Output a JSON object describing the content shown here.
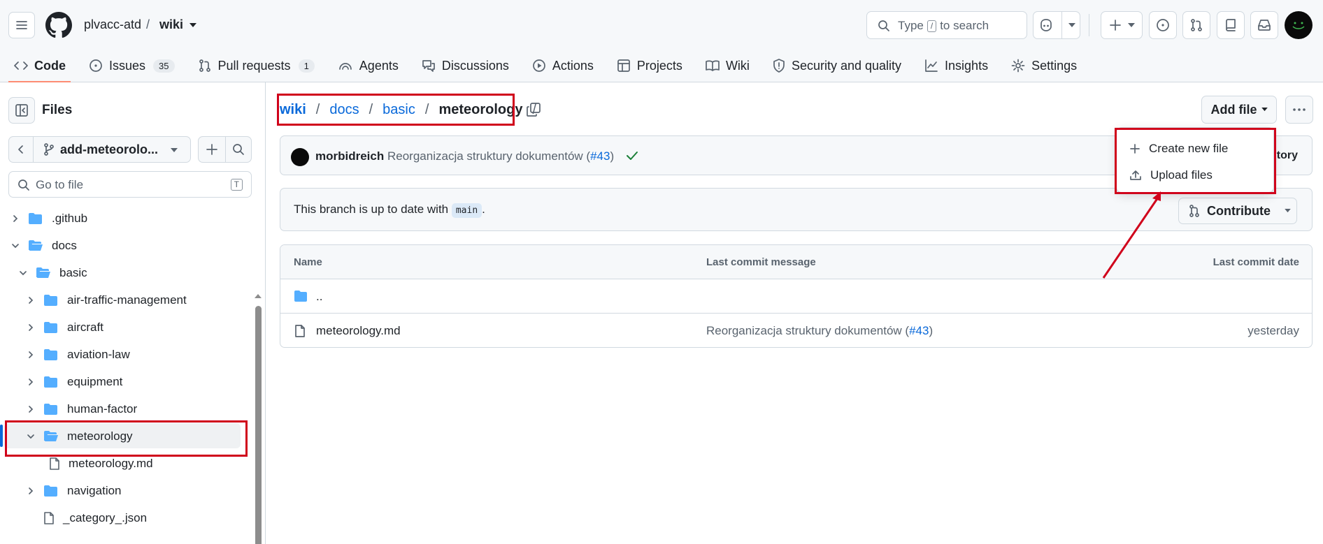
{
  "header": {
    "owner": "plvacc-atd",
    "separator": "/",
    "repo": "wiki",
    "search_placeholder": "Type",
    "search_key": "/",
    "search_suffix": "to search"
  },
  "tabs": [
    {
      "label": "Code",
      "icon": "code-icon"
    },
    {
      "label": "Issues",
      "icon": "issue-icon",
      "count": "35"
    },
    {
      "label": "Pull requests",
      "icon": "pull-request-icon",
      "count": "1"
    },
    {
      "label": "Agents",
      "icon": "agents-icon"
    },
    {
      "label": "Discussions",
      "icon": "discussions-icon"
    },
    {
      "label": "Actions",
      "icon": "actions-icon"
    },
    {
      "label": "Projects",
      "icon": "projects-icon"
    },
    {
      "label": "Wiki",
      "icon": "book-icon"
    },
    {
      "label": "Security and quality",
      "icon": "shield-icon"
    },
    {
      "label": "Insights",
      "icon": "graph-icon"
    },
    {
      "label": "Settings",
      "icon": "gear-icon"
    }
  ],
  "sidebar": {
    "title": "Files",
    "branch": "add-meteorolo...",
    "goto_placeholder": "Go to file",
    "goto_key": "T",
    "tree": [
      {
        "label": ".github",
        "type": "folder",
        "level": 0,
        "expanded": false
      },
      {
        "label": "docs",
        "type": "folder",
        "level": 0,
        "expanded": true
      },
      {
        "label": "basic",
        "type": "folder",
        "level": 1,
        "expanded": true
      },
      {
        "label": "air-traffic-management",
        "type": "folder",
        "level": 2,
        "expanded": false
      },
      {
        "label": "aircraft",
        "type": "folder",
        "level": 2,
        "expanded": false
      },
      {
        "label": "aviation-law",
        "type": "folder",
        "level": 2,
        "expanded": false
      },
      {
        "label": "equipment",
        "type": "folder",
        "level": 2,
        "expanded": false
      },
      {
        "label": "human-factor",
        "type": "folder",
        "level": 2,
        "expanded": false
      },
      {
        "label": "meteorology",
        "type": "folder",
        "level": 2,
        "expanded": true,
        "selected": true
      },
      {
        "label": "meteorology.md",
        "type": "file",
        "level": 3
      },
      {
        "label": "navigation",
        "type": "folder",
        "level": 2,
        "expanded": false
      },
      {
        "label": "_category_.json",
        "type": "file",
        "level": 2
      }
    ]
  },
  "breadcrumb": {
    "root": "wiki",
    "parts": [
      "docs",
      "basic"
    ],
    "current": "meteorology",
    "sep": "/"
  },
  "actions": {
    "add_file": "Add file",
    "create_new_file": "Create new file",
    "upload_files": "Upload files",
    "contribute": "Contribute"
  },
  "commit": {
    "user": "morbidreich",
    "message": "Reorganizacja struktury dokumentów (",
    "pr": "#43",
    "message_end": ")",
    "history": "tory"
  },
  "branch_status": {
    "prefix": "This branch is up to date with",
    "branch": "main",
    "suffix": "."
  },
  "table": {
    "headers": [
      "Name",
      "Last commit message",
      "Last commit date"
    ],
    "parent": "..",
    "rows": [
      {
        "name": "meteorology.md",
        "message": "Reorganizacja struktury dokumentów (",
        "pr": "#43",
        "message_end": ")",
        "date": "yesterday"
      }
    ]
  },
  "colors": {
    "accent": "#0969da",
    "annotation": "#d0021b",
    "folder": "#54aeff",
    "success": "#1a7f37"
  }
}
